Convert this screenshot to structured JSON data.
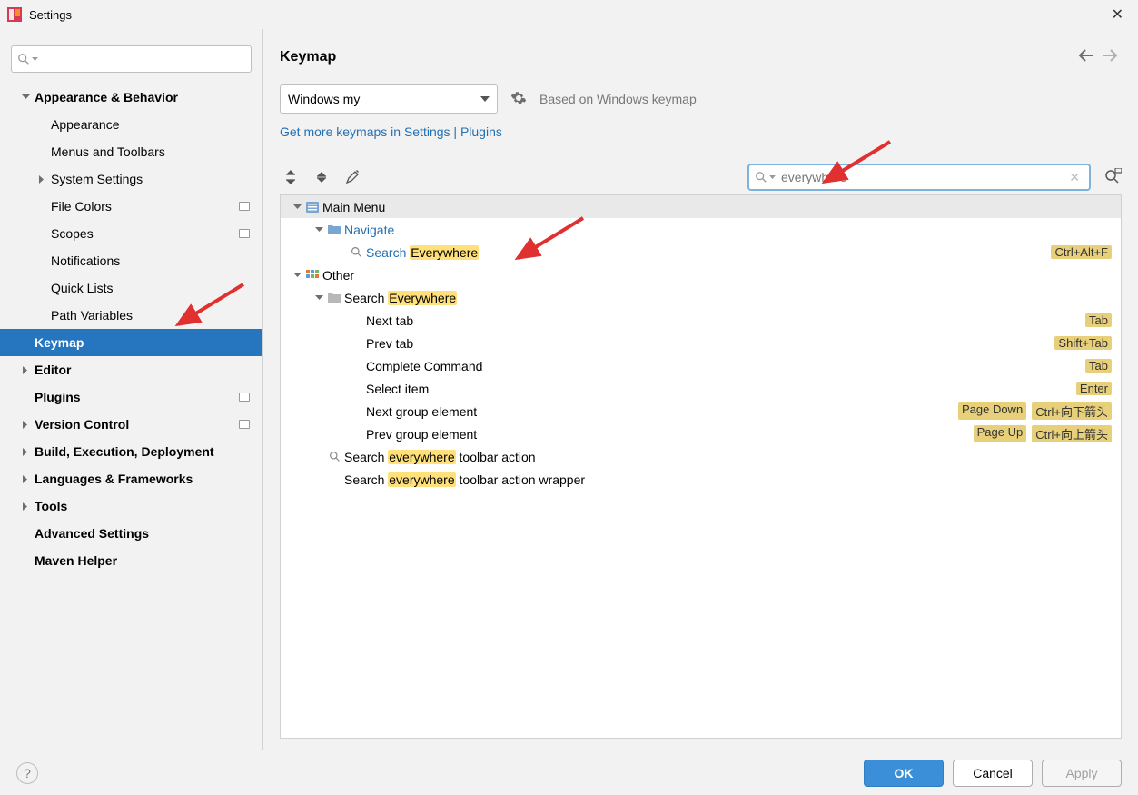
{
  "window": {
    "title": "Settings"
  },
  "sidebar": {
    "items": [
      {
        "label": "Appearance & Behavior",
        "level": "l1",
        "chev": "down",
        "badge": false
      },
      {
        "label": "Appearance",
        "level": "l2",
        "chev": "",
        "badge": false
      },
      {
        "label": "Menus and Toolbars",
        "level": "l2",
        "chev": "",
        "badge": false
      },
      {
        "label": "System Settings",
        "level": "l2b",
        "chev": "right",
        "badge": false
      },
      {
        "label": "File Colors",
        "level": "l2",
        "chev": "",
        "badge": true
      },
      {
        "label": "Scopes",
        "level": "l2",
        "chev": "",
        "badge": true
      },
      {
        "label": "Notifications",
        "level": "l2",
        "chev": "",
        "badge": false
      },
      {
        "label": "Quick Lists",
        "level": "l2",
        "chev": "",
        "badge": false
      },
      {
        "label": "Path Variables",
        "level": "l2",
        "chev": "",
        "badge": false
      },
      {
        "label": "Keymap",
        "level": "l1",
        "chev": "empty",
        "badge": false,
        "selected": true
      },
      {
        "label": "Editor",
        "level": "l1",
        "chev": "right",
        "badge": false
      },
      {
        "label": "Plugins",
        "level": "l1",
        "chev": "empty",
        "badge": true
      },
      {
        "label": "Version Control",
        "level": "l1",
        "chev": "right",
        "badge": true
      },
      {
        "label": "Build, Execution, Deployment",
        "level": "l1",
        "chev": "right",
        "badge": false
      },
      {
        "label": "Languages & Frameworks",
        "level": "l1",
        "chev": "right",
        "badge": false
      },
      {
        "label": "Tools",
        "level": "l1",
        "chev": "right",
        "badge": false
      },
      {
        "label": "Advanced Settings",
        "level": "l1",
        "chev": "empty",
        "badge": false
      },
      {
        "label": "Maven Helper",
        "level": "l1",
        "chev": "empty",
        "badge": false
      }
    ]
  },
  "main": {
    "title": "Keymap",
    "keymap_selected": "Windows my",
    "based_on": "Based on Windows keymap",
    "link": "Get more keymaps in Settings | Plugins",
    "search_value": "everywhere",
    "tree": [
      {
        "indent": 0,
        "chev": "down",
        "icon": "menu",
        "pre": "",
        "link": "",
        "highlight": "",
        "post": "Main Menu",
        "header": true,
        "shortcuts": []
      },
      {
        "indent": 1,
        "chev": "down",
        "icon": "folder-blue",
        "pre": "",
        "link": "Navigate",
        "highlight": "",
        "post": "",
        "shortcuts": []
      },
      {
        "indent": 2,
        "chev": "",
        "icon": "search",
        "pre": "",
        "link": "Search ",
        "highlight": "Everywhere",
        "post": "",
        "shortcuts": [
          "Ctrl+Alt+F"
        ]
      },
      {
        "indent": 0,
        "chev": "down",
        "icon": "other",
        "pre": "",
        "link": "",
        "highlight": "",
        "post": "Other",
        "shortcuts": []
      },
      {
        "indent": 1,
        "chev": "down",
        "icon": "folder",
        "pre": "Search ",
        "link": "",
        "highlight": "Everywhere",
        "post": "",
        "shortcuts": []
      },
      {
        "indent": 2,
        "chev": "",
        "icon": "",
        "pre": "Next tab",
        "link": "",
        "highlight": "",
        "post": "",
        "shortcuts": [
          "Tab"
        ]
      },
      {
        "indent": 2,
        "chev": "",
        "icon": "",
        "pre": "Prev tab",
        "link": "",
        "highlight": "",
        "post": "",
        "shortcuts": [
          "Shift+Tab"
        ]
      },
      {
        "indent": 2,
        "chev": "",
        "icon": "",
        "pre": "Complete Command",
        "link": "",
        "highlight": "",
        "post": "",
        "shortcuts": [
          "Tab"
        ]
      },
      {
        "indent": 2,
        "chev": "",
        "icon": "",
        "pre": "Select item",
        "link": "",
        "highlight": "",
        "post": "",
        "shortcuts": [
          "Enter"
        ]
      },
      {
        "indent": 2,
        "chev": "",
        "icon": "",
        "pre": "Next group element",
        "link": "",
        "highlight": "",
        "post": "",
        "shortcuts": [
          "Page Down",
          "Ctrl+向下箭头"
        ]
      },
      {
        "indent": 2,
        "chev": "",
        "icon": "",
        "pre": "Prev group element",
        "link": "",
        "highlight": "",
        "post": "",
        "shortcuts": [
          "Page Up",
          "Ctrl+向上箭头"
        ]
      },
      {
        "indent": 1,
        "chev": "",
        "icon": "search",
        "pre": "Search ",
        "link": "",
        "highlight": "everywhere",
        "post": " toolbar action",
        "shortcuts": []
      },
      {
        "indent": 1,
        "chev": "",
        "icon": "",
        "pre": "Search ",
        "link": "",
        "highlight": "everywhere",
        "post": " toolbar action wrapper",
        "shortcuts": []
      }
    ]
  },
  "footer": {
    "ok": "OK",
    "cancel": "Cancel",
    "apply": "Apply"
  }
}
